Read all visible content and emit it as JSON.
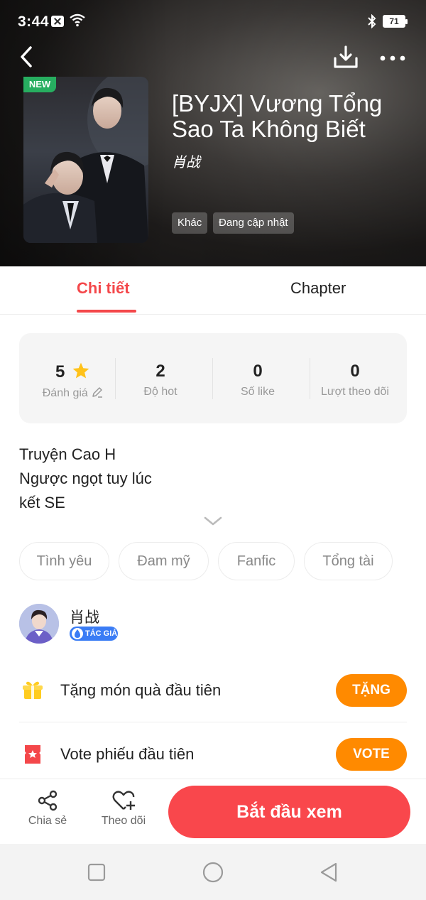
{
  "status_bar": {
    "time": "3:44",
    "battery": "71"
  },
  "header": {
    "new_badge": "NEW",
    "title": "[BYJX] Vương Tổng Sao Ta Không Biết",
    "author": "肖战",
    "tags": [
      "Khác",
      "Đang cập nhật"
    ]
  },
  "tabs": [
    {
      "label": "Chi tiết",
      "active": true
    },
    {
      "label": "Chapter",
      "active": false
    }
  ],
  "stats": [
    {
      "value": "5",
      "label": "Đánh giá",
      "icon": "star-icon"
    },
    {
      "value": "2",
      "label": "Độ hot"
    },
    {
      "value": "0",
      "label": "Số like"
    },
    {
      "value": "0",
      "label": "Lượt theo dõi"
    }
  ],
  "description": [
    "Truyện Cao H",
    "Ngược ngọt tuy lúc",
    "kết SE"
  ],
  "genres": [
    "Tình yêu",
    "Đam mỹ",
    "Fanfic",
    "Tổng tài"
  ],
  "author": {
    "name": "肖战",
    "badge": "TÁC GIẢ"
  },
  "gift_row": {
    "text": "Tặng món quà đầu tiên",
    "button": "TẶNG",
    "icon": "gift-icon"
  },
  "vote_row": {
    "text": "Vote phiếu đầu tiên",
    "button": "VOTE",
    "icon": "ticket-icon"
  },
  "bottom_bar": {
    "share": "Chia sẻ",
    "follow": "Theo dõi",
    "start": "Bắt đầu xem"
  },
  "colors": {
    "accent": "#f4474a",
    "orange": "#ff8a00",
    "badge_blue": "#3a7cf5",
    "new_green": "#27ae60"
  }
}
